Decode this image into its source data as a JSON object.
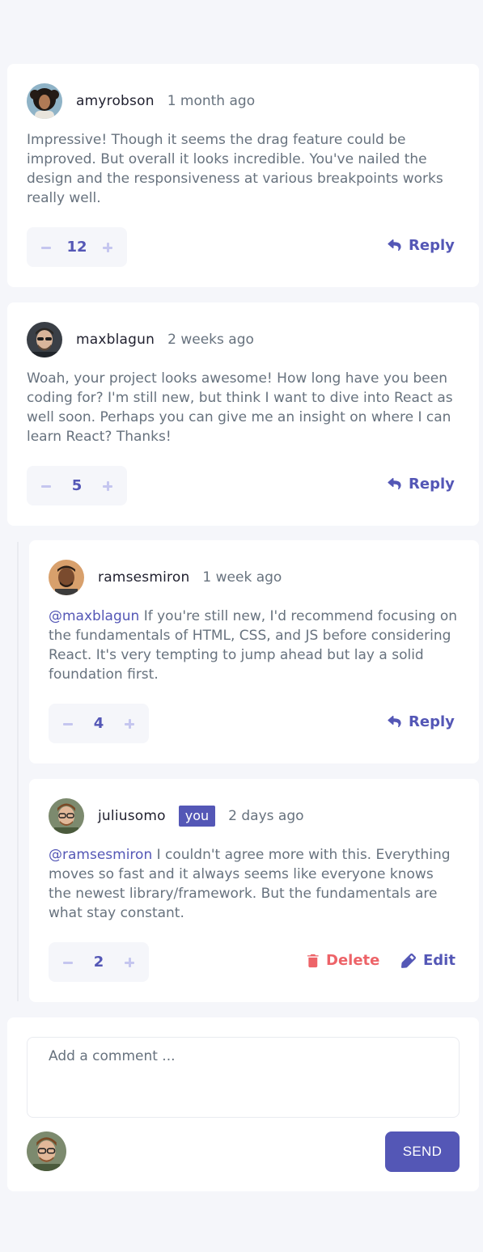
{
  "comments": [
    {
      "username": "amyrobson",
      "time": "1 month ago",
      "content": "Impressive! Though it seems the drag feature could be improved. But overall it looks incredible. You've nailed the design and the responsiveness at various breakpoints works really well.",
      "score": "12",
      "reply_label": "Reply"
    },
    {
      "username": "maxblagun",
      "time": "2 weeks ago",
      "content": "Woah, your project looks awesome! How long have you been coding for? I'm still new, but think I want to dive into React as well soon. Perhaps you can give me an insight on where I can learn React? Thanks!",
      "score": "5",
      "reply_label": "Reply"
    }
  ],
  "replies": [
    {
      "username": "ramsesmiron",
      "time": "1 week ago",
      "replying_to": "@maxblagun",
      "content": " If you're still new, I'd recommend focusing on the fundamentals of HTML, CSS, and JS before considering React. It's very tempting to jump ahead but lay a solid foundation first.",
      "score": "4",
      "reply_label": "Reply"
    },
    {
      "username": "juliusomo",
      "badge": "you",
      "time": "2 days ago",
      "replying_to": "@ramsesmiron",
      "content": " I couldn't agree more with this. Everything moves so fast and it always seems like everyone knows the newest library/framework. But the fundamentals are what stay constant.",
      "score": "2",
      "delete_label": "Delete",
      "edit_label": "Edit"
    }
  ],
  "composer": {
    "placeholder": "Add a comment ...",
    "send_label": "SEND"
  },
  "colors": {
    "primary": "#5457b6",
    "danger": "#ed6368",
    "muted": "#67727e",
    "vote_icon": "#c5c6ef",
    "background": "#f5f6fa"
  },
  "icons": {
    "reply": "reply-icon",
    "delete": "trash-icon",
    "edit": "pencil-icon",
    "upvote": "plus-icon",
    "downvote": "minus-icon"
  }
}
